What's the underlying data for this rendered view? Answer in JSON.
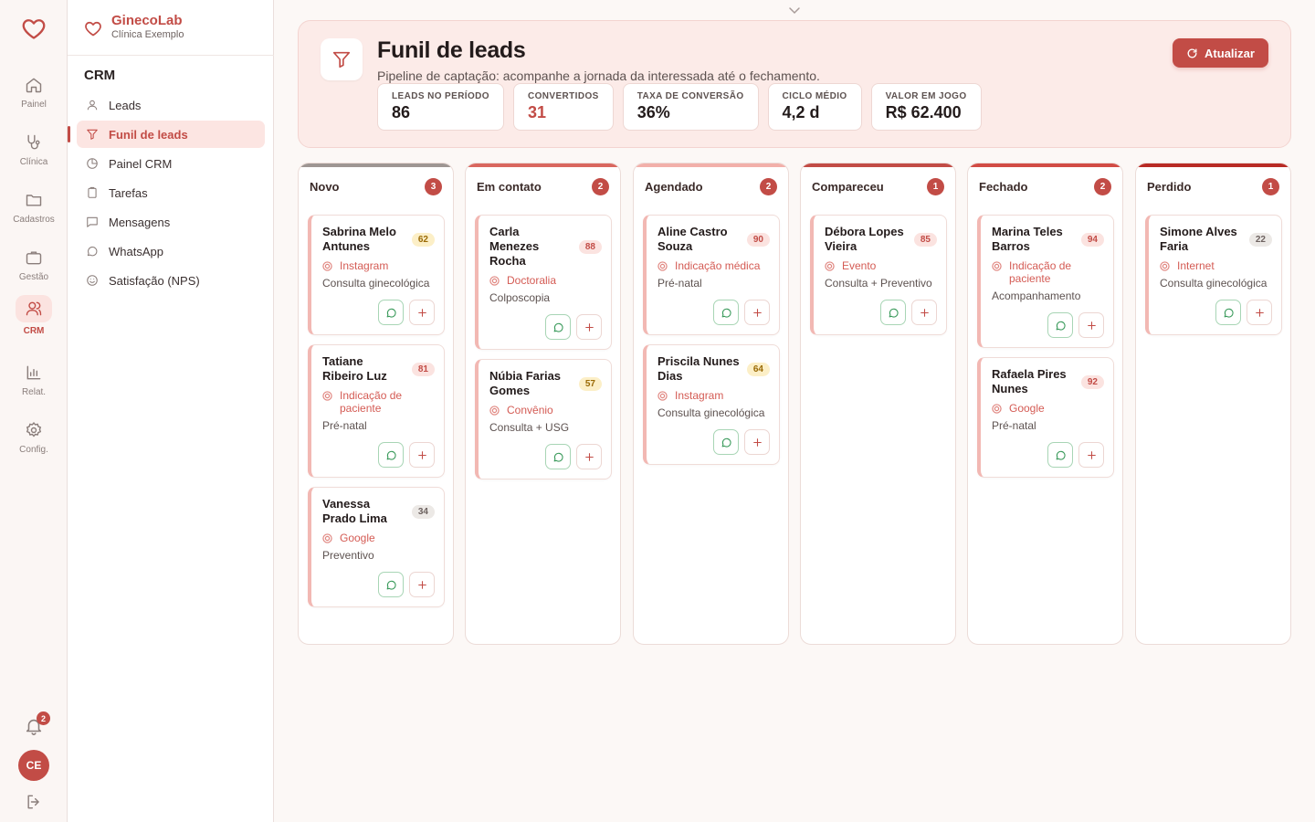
{
  "rail": {
    "items": [
      {
        "label": "Painel",
        "icon": "home-icon"
      },
      {
        "label": "Clínica",
        "icon": "stethoscope-icon"
      },
      {
        "label": "Cadastros",
        "icon": "folder-icon"
      },
      {
        "label": "Gestão",
        "icon": "briefcase-icon"
      },
      {
        "label": "CRM",
        "icon": "users-icon",
        "active": true
      },
      {
        "label": "Relat.",
        "icon": "bar-chart-icon"
      },
      {
        "label": "Config.",
        "icon": "gear-icon"
      }
    ],
    "notifications": "2",
    "avatar": "CE"
  },
  "brand": {
    "name": "GinecoLab",
    "subtitle": "Clínica Exemplo"
  },
  "sidebar": {
    "section": "CRM",
    "items": [
      {
        "label": "Leads",
        "icon": "user-icon"
      },
      {
        "label": "Funil de leads",
        "icon": "funnel-icon",
        "active": true
      },
      {
        "label": "Painel CRM",
        "icon": "pie-chart-icon"
      },
      {
        "label": "Tarefas",
        "icon": "clipboard-icon"
      },
      {
        "label": "Mensagens",
        "icon": "message-square-icon"
      },
      {
        "label": "WhatsApp",
        "icon": "chat-bubble-icon"
      },
      {
        "label": "Satisfação (NPS)",
        "icon": "smile-icon"
      }
    ]
  },
  "header": {
    "title": "Funil de leads",
    "subtitle": "Pipeline de captação: acompanhe a jornada da interessada até o fechamento.",
    "refresh_label": "Atualizar",
    "kpis": [
      {
        "label": "LEADS NO PERÍODO",
        "value": "86"
      },
      {
        "label": "CONVERTIDOS",
        "value": "31",
        "accent": true
      },
      {
        "label": "TAXA DE CONVERSÃO",
        "value": "36%"
      },
      {
        "label": "CICLO MÉDIO",
        "value": "4,2 d"
      },
      {
        "label": "VALOR EM JOGO",
        "value": "R$ 62.400"
      }
    ]
  },
  "colors": {
    "accent": "#c24c46",
    "stage_bars": [
      "#9e9693",
      "#d9675f",
      "#f2b0aa",
      "#c24c46",
      "#d24c45",
      "#b82b25"
    ]
  },
  "columns": [
    {
      "title": "Novo",
      "count": "3",
      "cards": [
        {
          "name": "Sabrina Melo Antunes",
          "score": "62",
          "level": "warm",
          "source": "Instagram",
          "service": "Consulta ginecológica"
        },
        {
          "name": "Tatiane Ribeiro Luz",
          "score": "81",
          "level": "hot",
          "source": "Indicação de paciente",
          "service": "Pré-natal"
        },
        {
          "name": "Vanessa Prado Lima",
          "score": "34",
          "level": "cold",
          "source": "Google",
          "service": "Preventivo"
        }
      ]
    },
    {
      "title": "Em contato",
      "count": "2",
      "cards": [
        {
          "name": "Carla Menezes Rocha",
          "score": "88",
          "level": "hot",
          "source": "Doctoralia",
          "service": "Colposcopia"
        },
        {
          "name": "Núbia Farias Gomes",
          "score": "57",
          "level": "warm",
          "source": "Convênio",
          "service": "Consulta + USG"
        }
      ]
    },
    {
      "title": "Agendado",
      "count": "2",
      "cards": [
        {
          "name": "Aline Castro Souza",
          "score": "90",
          "level": "hot",
          "source": "Indicação médica",
          "service": "Pré-natal"
        },
        {
          "name": "Priscila Nunes Dias",
          "score": "64",
          "level": "warm",
          "source": "Instagram",
          "service": "Consulta ginecológica"
        }
      ]
    },
    {
      "title": "Compareceu",
      "count": "1",
      "cards": [
        {
          "name": "Débora Lopes Vieira",
          "score": "85",
          "level": "hot",
          "source": "Evento",
          "service": "Consulta + Preventivo"
        }
      ]
    },
    {
      "title": "Fechado",
      "count": "2",
      "cards": [
        {
          "name": "Marina Teles Barros",
          "score": "94",
          "level": "hot",
          "source": "Indicação de paciente",
          "service": "Acompanhamento"
        },
        {
          "name": "Rafaela Pires Nunes",
          "score": "92",
          "level": "hot",
          "source": "Google",
          "service": "Pré-natal"
        }
      ]
    },
    {
      "title": "Perdido",
      "count": "1",
      "cards": [
        {
          "name": "Simone Alves Faria",
          "score": "22",
          "level": "cold",
          "source": "Internet",
          "service": "Consulta ginecológica"
        }
      ]
    }
  ]
}
